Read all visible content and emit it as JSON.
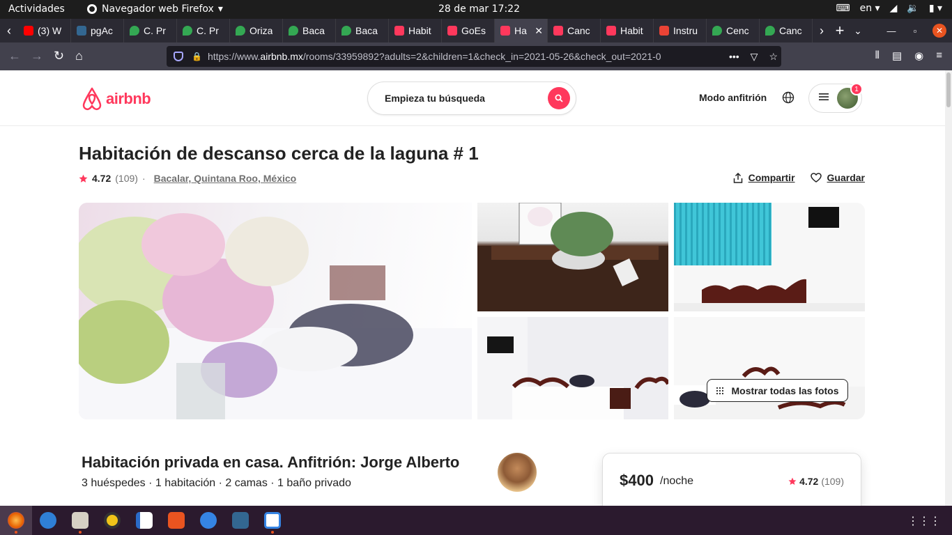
{
  "system": {
    "activities": "Actividades",
    "app_name": "Navegador web Firefox",
    "clock": "28 de mar  17:22",
    "lang": "en"
  },
  "tabs": [
    {
      "label": "(3) W",
      "icon": "youtube-icon"
    },
    {
      "label": "pgAc",
      "icon": "pgadmin-icon"
    },
    {
      "label": "C. Pr",
      "icon": "maps-pin-icon"
    },
    {
      "label": "C. Pr",
      "icon": "maps-pin-icon"
    },
    {
      "label": "Oriza",
      "icon": "maps-pin-icon"
    },
    {
      "label": "Baca",
      "icon": "maps-pin-icon"
    },
    {
      "label": "Baca",
      "icon": "maps-pin-icon"
    },
    {
      "label": "Habit",
      "icon": "airbnb-icon"
    },
    {
      "label": "GoEs",
      "icon": "airbnb-icon"
    },
    {
      "label": "Ha",
      "icon": "airbnb-icon",
      "active": true
    },
    {
      "label": "Canc",
      "icon": "airbnb-icon"
    },
    {
      "label": "Habit",
      "icon": "airbnb-icon"
    },
    {
      "label": "Instru",
      "icon": "gmail-icon"
    },
    {
      "label": "Cenc",
      "icon": "maps-pin-icon"
    },
    {
      "label": "Canc",
      "icon": "maps-pin-icon"
    }
  ],
  "nav": {
    "url_prefix": "https://www.",
    "url_host": "airbnb.mx",
    "url_rest": "/rooms/33959892?adults=2&children=1&check_in=2021-05-26&check_out=2021-0",
    "more": "•••"
  },
  "header": {
    "logo_text": "airbnb",
    "search_placeholder": "Empieza tu búsqueda",
    "host_mode": "Modo anfitrión",
    "badge_count": "1"
  },
  "listing": {
    "title": "Habitación de descanso cerca de la laguna # 1",
    "rating": "4.72",
    "reviews": "(109)",
    "separator": "·",
    "location": "Bacalar, Quintana Roo, México",
    "share": "Compartir",
    "save": "Guardar",
    "show_all_photos": "Mostrar todas las fotos",
    "subtitle": "Habitación privada en casa. Anfitrión: Jorge Alberto",
    "details": "3 huéspedes · 1 habitación · 2 camas · 1 baño privado"
  },
  "booking": {
    "price": "$400",
    "per_night": "/noche",
    "rating": "4.72",
    "reviews": "(109)"
  },
  "colors": {
    "brand": "#ff385c",
    "text": "#222222",
    "muted": "#717171"
  }
}
